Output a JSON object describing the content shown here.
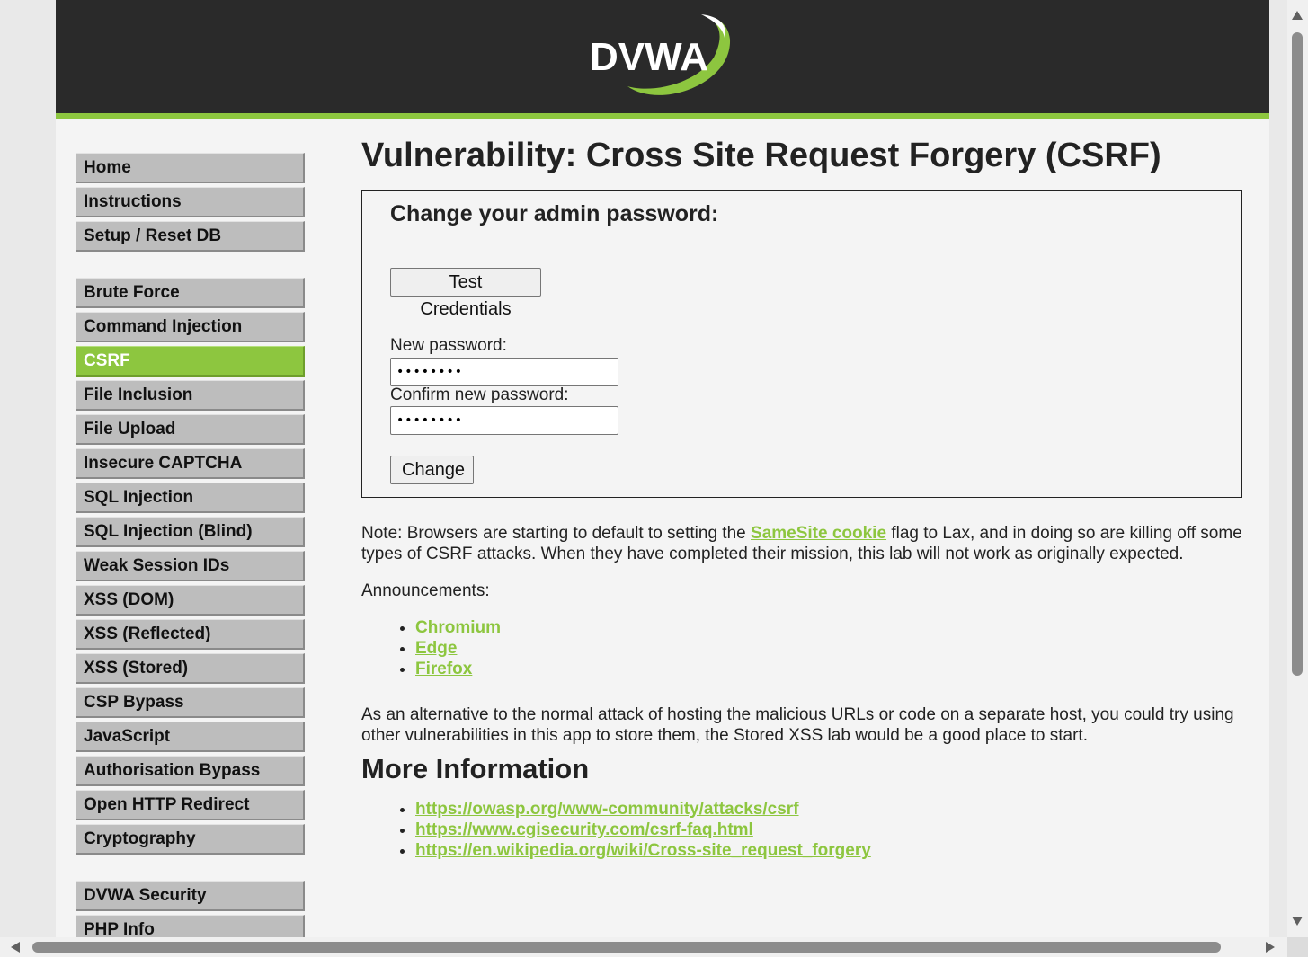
{
  "colors": {
    "accent": "#8dc63f",
    "header_bg": "#2a2a2a",
    "page_bg": "#f4f4f4",
    "menu_bg": "#bdbdbd"
  },
  "logo": {
    "text": "DVWA"
  },
  "menu": {
    "group1": [
      "Home",
      "Instructions",
      "Setup / Reset DB"
    ],
    "group2": [
      "Brute Force",
      "Command Injection",
      "CSRF",
      "File Inclusion",
      "File Upload",
      "Insecure CAPTCHA",
      "SQL Injection",
      "SQL Injection (Blind)",
      "Weak Session IDs",
      "XSS (DOM)",
      "XSS (Reflected)",
      "XSS (Stored)",
      "CSP Bypass",
      "JavaScript",
      "Authorisation Bypass",
      "Open HTTP Redirect",
      "Cryptography"
    ],
    "group3": [
      "DVWA Security",
      "PHP Info"
    ],
    "selected": "CSRF"
  },
  "main": {
    "title": "Vulnerability: Cross Site Request Forgery (CSRF)",
    "form": {
      "heading": "Change your admin password:",
      "test_button": "Test Credentials",
      "new_password_label": "New password:",
      "new_password_value": "••••••••",
      "confirm_password_label": "Confirm new password:",
      "confirm_password_value": "••••••••",
      "change_button": "Change"
    },
    "note": {
      "before": "Note: Browsers are starting to default to setting the ",
      "link": "SameSite cookie",
      "after": " flag to Lax, and in doing so are killing off some types of CSRF attacks. When they have completed their mission, this lab will not work as originally expected."
    },
    "announcements_label": "Announcements:",
    "announcements": [
      "Chromium",
      "Edge",
      "Firefox"
    ],
    "alternative_text": "As an alternative to the normal attack of hosting the malicious URLs or code on a separate host, you could try using other vulnerabilities in this app to store them, the Stored XSS lab would be a good place to start.",
    "more_info_heading": "More Information",
    "more_info_links": [
      "https://owasp.org/www-community/attacks/csrf",
      "https://www.cgisecurity.com/csrf-faq.html",
      "https://en.wikipedia.org/wiki/Cross-site_request_forgery"
    ]
  }
}
